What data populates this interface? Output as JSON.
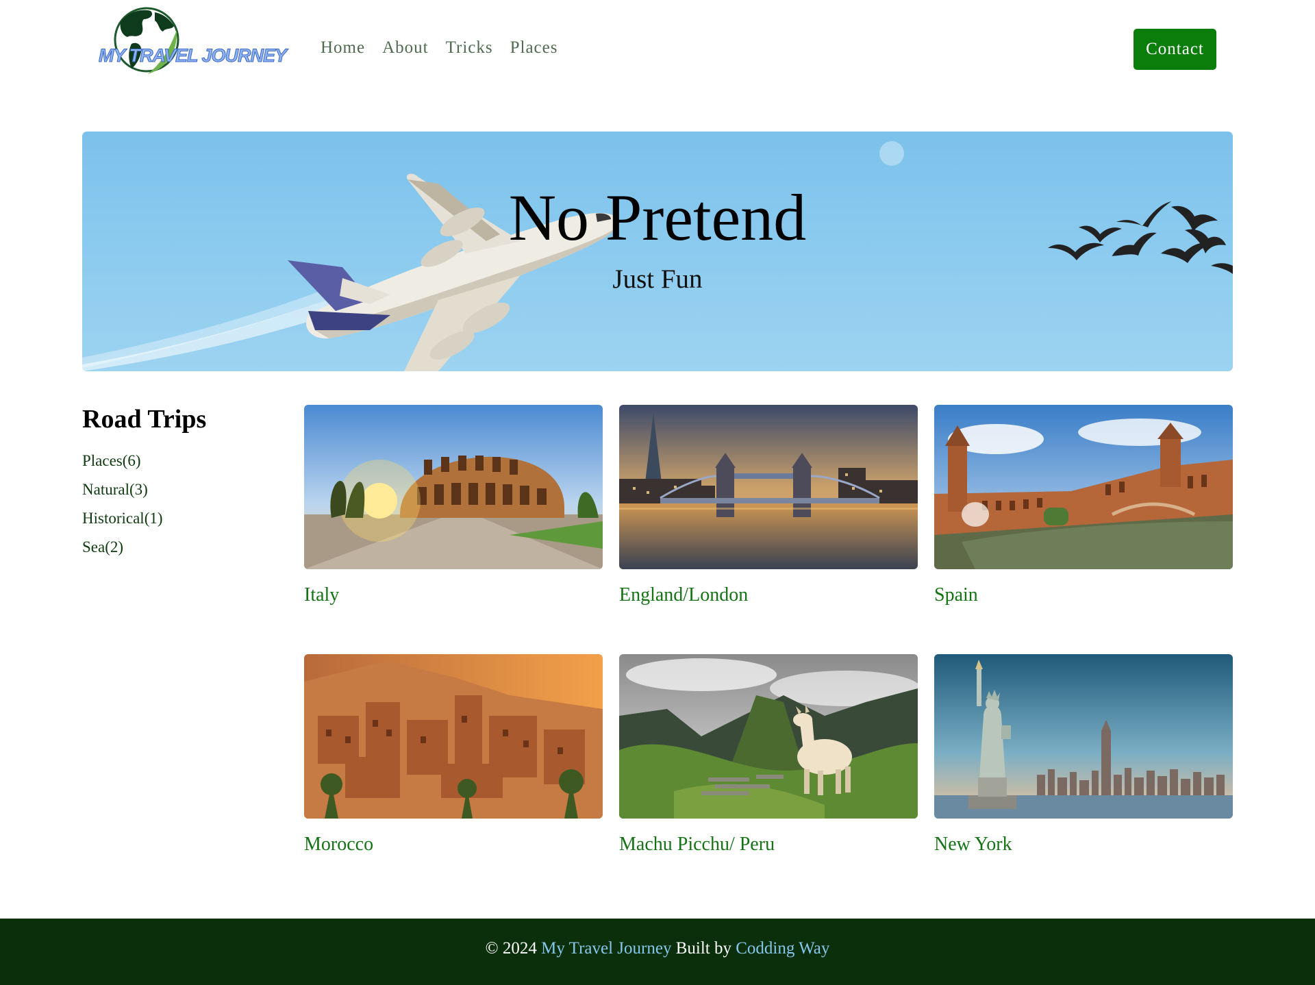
{
  "brand": {
    "logo_text": "MY TRAVEL JOURNEY",
    "colors": {
      "green": "#0b7d0b",
      "footer": "#0a2f0a",
      "link": "#157315"
    }
  },
  "nav": {
    "items": [
      {
        "label": "Home"
      },
      {
        "label": "About"
      },
      {
        "label": "Tricks"
      },
      {
        "label": "Places"
      }
    ],
    "contact_label": "Contact"
  },
  "hero": {
    "title": "No Pretend",
    "subtitle": "Just Fun"
  },
  "sidebar": {
    "heading": "Road Trips",
    "categories": [
      {
        "label": "Places(6)"
      },
      {
        "label": "Natural(3)"
      },
      {
        "label": "Historical(1)"
      },
      {
        "label": "Sea(2)"
      }
    ]
  },
  "destinations": [
    {
      "title": "Italy",
      "image": "colosseum-sunset"
    },
    {
      "title": "England/London",
      "image": "tower-bridge-dusk"
    },
    {
      "title": "Spain",
      "image": "plaza-de-espana"
    },
    {
      "title": "Morocco",
      "image": "ait-benhaddou-kasbah"
    },
    {
      "title": "Machu Picchu/ Peru",
      "image": "machu-picchu-llama"
    },
    {
      "title": "New York",
      "image": "statue-of-liberty-skyline"
    }
  ],
  "footer": {
    "prefix": "© 2024",
    "site_name": "My Travel Journey",
    "middle": "Built by",
    "author": "Codding Way"
  }
}
